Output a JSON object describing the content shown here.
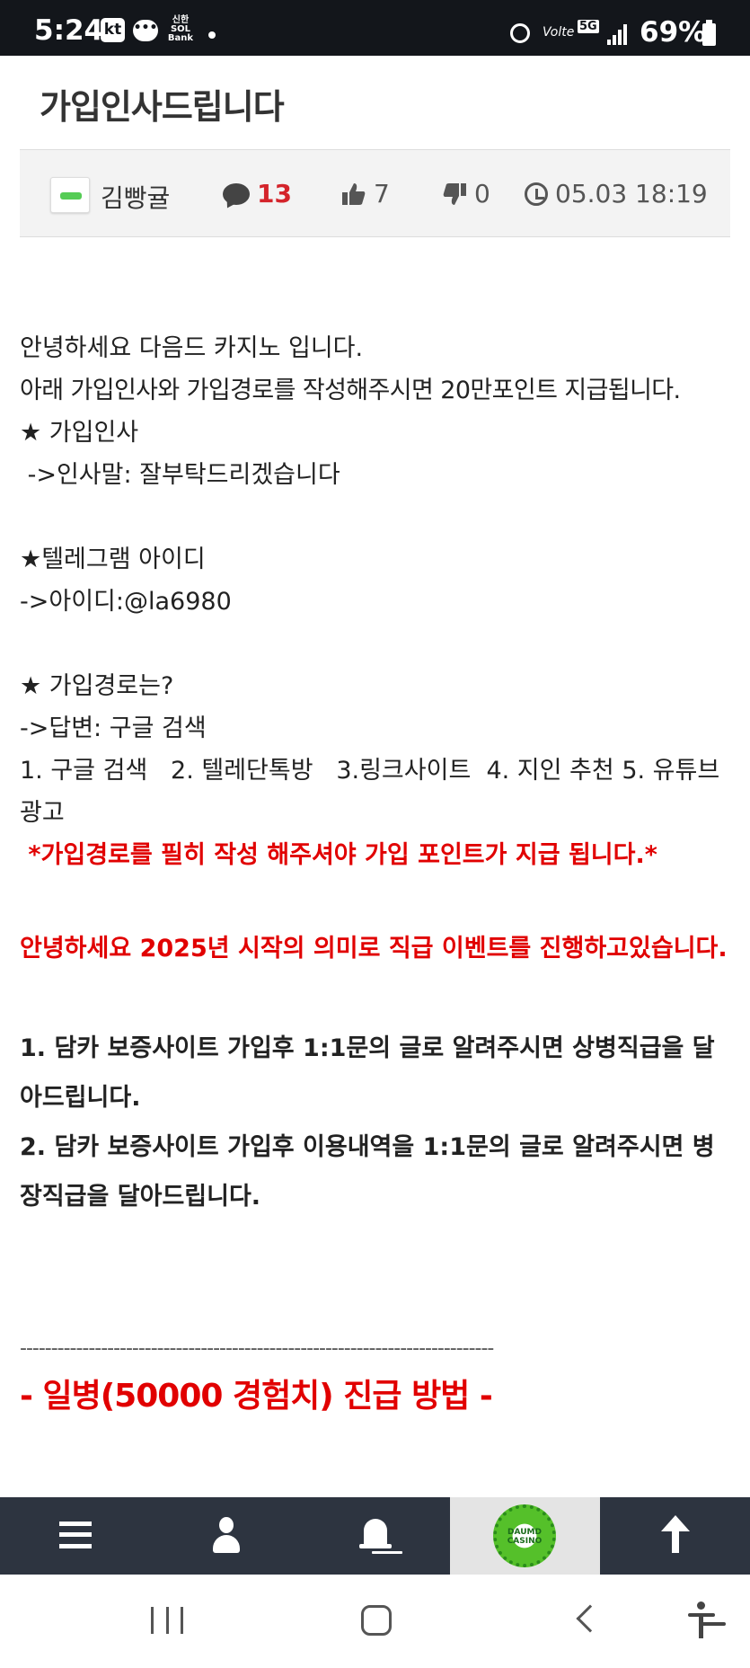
{
  "status_bar": {
    "time": "5:24",
    "carrier": "kt",
    "bank_line1": "신한",
    "bank_line2": "SOL",
    "bank_line3": "Bank",
    "volte": "Volte",
    "network": "5G",
    "battery": "69%"
  },
  "post": {
    "title": "가입인사드립니다",
    "author": "김빵귤",
    "comments": "13",
    "likes": "7",
    "dislikes": "0",
    "date": "05.03 18:19"
  },
  "content": {
    "l1": "안녕하세요 다음드 카지노 입니다.",
    "l2": "아래 가입인사와 가입경로를 작성해주시면 20만포인트 지급됩니다.",
    "l3": "★ 가입인사",
    "l4": " ->인사말: 잘부탁드리겠습니다",
    "l5": "★텔레그램 아이디",
    "l6": "->아이디:@la6980",
    "l7": "★ 가입경로는?",
    "l8": "->답변: 구글 검색",
    "l9": "1. 구글 검색   2. 텔레단톡방   3.링크사이트  4. 지인 추천 5. 유튜브광고",
    "l10": " *가입경로를 필히 작성 해주셔야 가입 포인트가 지급 됩니다.*",
    "l11": "안녕하세요 2025년 시작의 의미로 직급 이벤트를 진행하고있습니다.",
    "l12": "1. 담카 보증사이트 가입후 1:1문의 글로 알려주시면 상병직급을 달아드립니다.",
    "l13": "2. 담카 보증사이트 가입후 이용내역을 1:1문의 글로 알려주시면 병장직급을 달아드립니다.",
    "divider": "----------------------------------------------------------------------------",
    "heading": "- 일병(50000 경험치) 진급 방법 -"
  },
  "bottom_nav": {
    "logo_line1": "DAUMD",
    "logo_line2": "CASINO"
  },
  "colors": {
    "accent_red": "#e10000",
    "nav_bg": "#2d3440",
    "status_bg": "#13161b"
  }
}
